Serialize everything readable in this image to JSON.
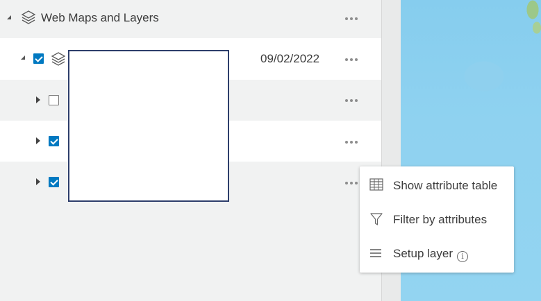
{
  "tree": {
    "group": {
      "label": "Web Maps and Layers"
    },
    "webmap": {
      "date": "09/02/2022",
      "checked": true
    },
    "layers": [
      {
        "checked": false
      },
      {
        "checked": true
      },
      {
        "checked": true
      }
    ]
  },
  "context_menu": {
    "items": [
      {
        "label": "Show attribute table",
        "icon": "table-icon"
      },
      {
        "label": "Filter by attributes",
        "icon": "filter-icon"
      },
      {
        "label": "Setup layer",
        "icon": "list-icon",
        "info_glyph": "i"
      }
    ]
  },
  "colors": {
    "accent": "#0079c1",
    "map_water": "#8fd2f0",
    "land": "#9cc889"
  }
}
